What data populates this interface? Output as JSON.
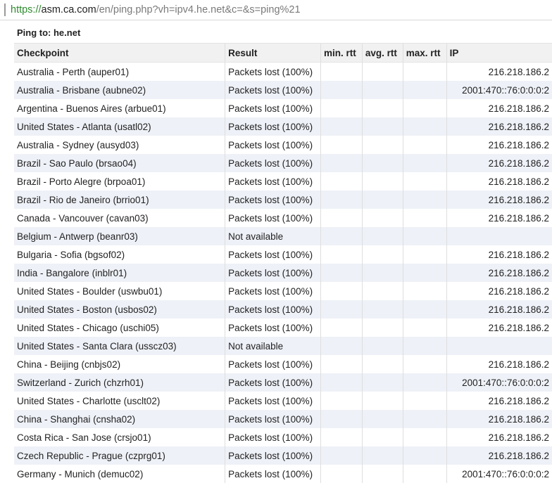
{
  "address_bar": {
    "scheme": "https://",
    "host": "asm.ca.com",
    "path": "/en/ping.php?vh=ipv4.he.net&c=&s=ping%21"
  },
  "caption": "Ping to: he.net",
  "table": {
    "headers": [
      "Checkpoint",
      "Result",
      "min. rtt",
      "avg. rtt",
      "max. rtt",
      "IP"
    ],
    "rows": [
      [
        "Australia - Perth (auper01)",
        "Packets lost (100%)",
        "",
        "",
        "",
        "216.218.186.2"
      ],
      [
        "Australia - Brisbane (aubne02)",
        "Packets lost (100%)",
        "",
        "",
        "",
        "2001:470::76:0:0:0:2"
      ],
      [
        "Argentina - Buenos Aires (arbue01)",
        "Packets lost (100%)",
        "",
        "",
        "",
        "216.218.186.2"
      ],
      [
        "United States - Atlanta (usatl02)",
        "Packets lost (100%)",
        "",
        "",
        "",
        "216.218.186.2"
      ],
      [
        "Australia - Sydney (ausyd03)",
        "Packets lost (100%)",
        "",
        "",
        "",
        "216.218.186.2"
      ],
      [
        "Brazil - Sao Paulo (brsao04)",
        "Packets lost (100%)",
        "",
        "",
        "",
        "216.218.186.2"
      ],
      [
        "Brazil - Porto Alegre (brpoa01)",
        "Packets lost (100%)",
        "",
        "",
        "",
        "216.218.186.2"
      ],
      [
        "Brazil - Rio de Janeiro (brrio01)",
        "Packets lost (100%)",
        "",
        "",
        "",
        "216.218.186.2"
      ],
      [
        "Canada - Vancouver (cavan03)",
        "Packets lost (100%)",
        "",
        "",
        "",
        "216.218.186.2"
      ],
      [
        "Belgium - Antwerp (beanr03)",
        "Not available",
        "",
        "",
        "",
        ""
      ],
      [
        "Bulgaria - Sofia (bgsof02)",
        "Packets lost (100%)",
        "",
        "",
        "",
        "216.218.186.2"
      ],
      [
        "India - Bangalore (inblr01)",
        "Packets lost (100%)",
        "",
        "",
        "",
        "216.218.186.2"
      ],
      [
        "United States - Boulder (uswbu01)",
        "Packets lost (100%)",
        "",
        "",
        "",
        "216.218.186.2"
      ],
      [
        "United States - Boston (usbos02)",
        "Packets lost (100%)",
        "",
        "",
        "",
        "216.218.186.2"
      ],
      [
        "United States - Chicago (uschi05)",
        "Packets lost (100%)",
        "",
        "",
        "",
        "216.218.186.2"
      ],
      [
        "United States - Santa Clara (usscz03)",
        "Not available",
        "",
        "",
        "",
        ""
      ],
      [
        "China - Beijing (cnbjs02)",
        "Packets lost (100%)",
        "",
        "",
        "",
        "216.218.186.2"
      ],
      [
        "Switzerland - Zurich (chzrh01)",
        "Packets lost (100%)",
        "",
        "",
        "",
        "2001:470::76:0:0:0:2"
      ],
      [
        "United States - Charlotte (usclt02)",
        "Packets lost (100%)",
        "",
        "",
        "",
        "216.218.186.2"
      ],
      [
        "China - Shanghai (cnsha02)",
        "Packets lost (100%)",
        "",
        "",
        "",
        "216.218.186.2"
      ],
      [
        "Costa Rica - San Jose (crsjo01)",
        "Packets lost (100%)",
        "",
        "",
        "",
        "216.218.186.2"
      ],
      [
        "Czech Republic - Prague (czprg01)",
        "Packets lost (100%)",
        "",
        "",
        "",
        "216.218.186.2"
      ],
      [
        "Germany - Munich (demuc02)",
        "Packets lost (100%)",
        "",
        "",
        "",
        "2001:470::76:0:0:0:2"
      ]
    ]
  },
  "colors": {
    "scheme_green": "#2e8b2e",
    "row_stripe": "#eef1f7",
    "header_bg": "#f1f1f1"
  }
}
